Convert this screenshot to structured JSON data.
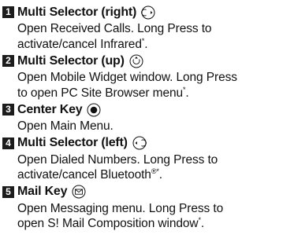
{
  "items": [
    {
      "number": "1",
      "title": "Multi Selector (right)",
      "icon": "multi-selector-right-icon",
      "desc_lines": [
        "Open Received Calls. Long Press to",
        "activate/cancel Infrared"
      ],
      "desc_suffix": "*",
      "desc_end": "."
    },
    {
      "number": "2",
      "title": "Multi Selector (up)",
      "icon": "multi-selector-up-icon",
      "desc_lines": [
        "Open Mobile Widget window. Long Press",
        "to open PC Site Browser menu"
      ],
      "desc_suffix": "*",
      "desc_end": "."
    },
    {
      "number": "3",
      "title": "Center Key",
      "icon": "center-key-icon",
      "desc_lines": [
        "Open Main Menu."
      ],
      "desc_suffix": "",
      "desc_end": ""
    },
    {
      "number": "4",
      "title": "Multi Selector (left)",
      "icon": "multi-selector-left-icon",
      "desc_lines": [
        "Open Dialed Numbers. Long Press to",
        "activate/cancel Bluetooth"
      ],
      "desc_suffix": "®*",
      "desc_end": "."
    },
    {
      "number": "5",
      "title": "Mail Key",
      "icon": "mail-key-icon",
      "desc_lines": [
        "Open Messaging menu. Long Press to",
        "open S! Mail Composition window"
      ],
      "desc_suffix": "*",
      "desc_end": "."
    }
  ]
}
